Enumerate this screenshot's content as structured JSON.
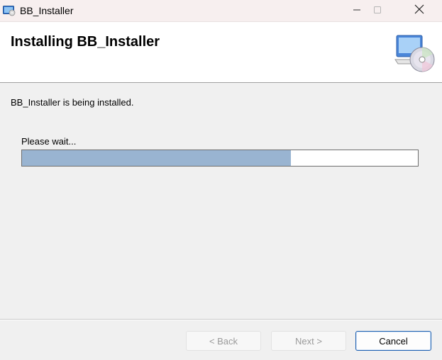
{
  "window": {
    "title": "BB_Installer",
    "icon": "installer-app-icon",
    "controls": [
      "minimize-icon",
      "maximize-icon",
      "close-icon"
    ]
  },
  "header": {
    "title": "Installing BB_Installer",
    "icon": "computer-disc-icon"
  },
  "main": {
    "status_text": "BB_Installer is being installed.",
    "wait_label": "Please wait...",
    "progress_fraction": 0.68,
    "progress_color": "#99b4d1"
  },
  "buttons": {
    "back_label": "< Back",
    "next_label": "Next >",
    "cancel_label": "Cancel"
  },
  "colors": {
    "accent_border": "#1c5fb0"
  }
}
